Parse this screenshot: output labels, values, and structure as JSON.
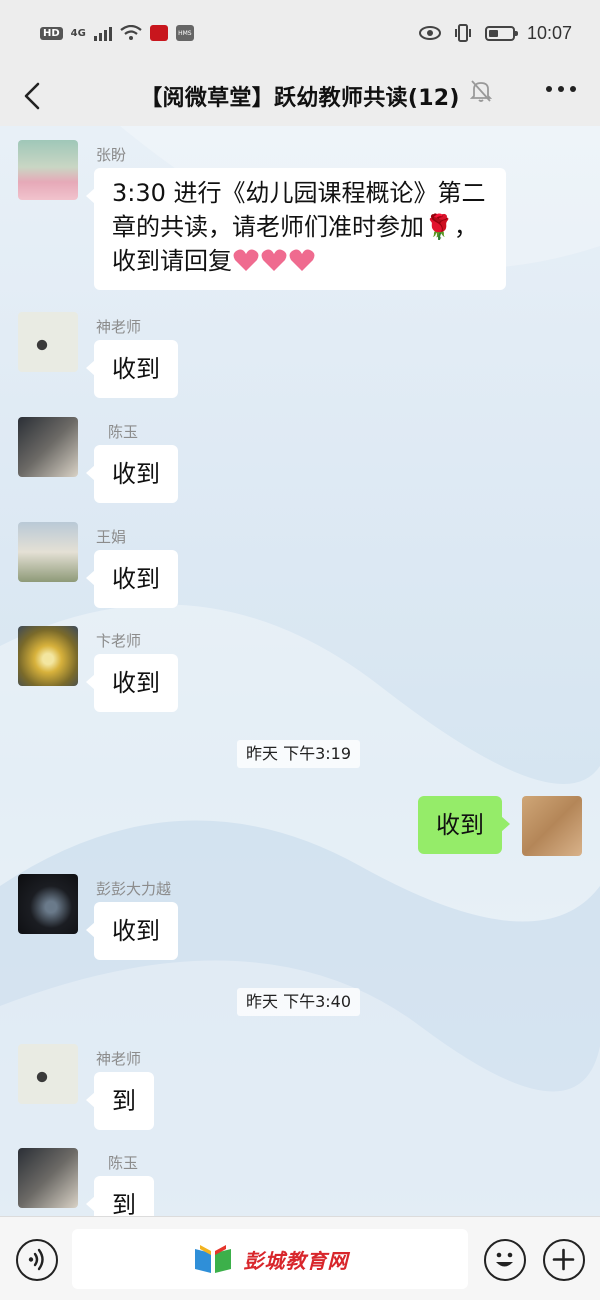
{
  "status_bar": {
    "hd_badge": "HD",
    "network": "4G",
    "app_badge": "HMS",
    "time": "10:07"
  },
  "header": {
    "title": "【阅微草堂】跃幼教师共读(12)",
    "icons": [
      "back-arrow-icon",
      "mute-bell-icon",
      "more-dots-icon"
    ]
  },
  "messages": [
    {
      "sender": "张盼",
      "text_lines": [
        "3:30 进行《幼儿园课程概论》第二",
        "章的共读，请老师们准时参加🌹，",
        "收到请回复"
      ],
      "hearts": 3
    },
    {
      "sender": "神老师",
      "text": "收到"
    },
    {
      "sender": "陈玉",
      "text": "收到"
    },
    {
      "sender": "王娟",
      "text": "收到"
    },
    {
      "sender": "卞老师",
      "text": "收到"
    },
    {
      "timestamp": "昨天 下午3:19"
    },
    {
      "sender": "me",
      "text": "收到"
    },
    {
      "sender": "彭彭大力越",
      "text": "收到"
    },
    {
      "timestamp": "昨天 下午3:40"
    },
    {
      "sender": "神老师",
      "text": "到"
    },
    {
      "sender": "陈玉",
      "text": "到"
    }
  ],
  "input_bar": {
    "watermark": "彭城教育网",
    "icons": [
      "voice-icon",
      "emoji-icon",
      "plus-icon"
    ]
  },
  "colors": {
    "my_bubble": "#95ec69",
    "other_bubble": "#ffffff",
    "watermark_red": "#d8262b"
  }
}
